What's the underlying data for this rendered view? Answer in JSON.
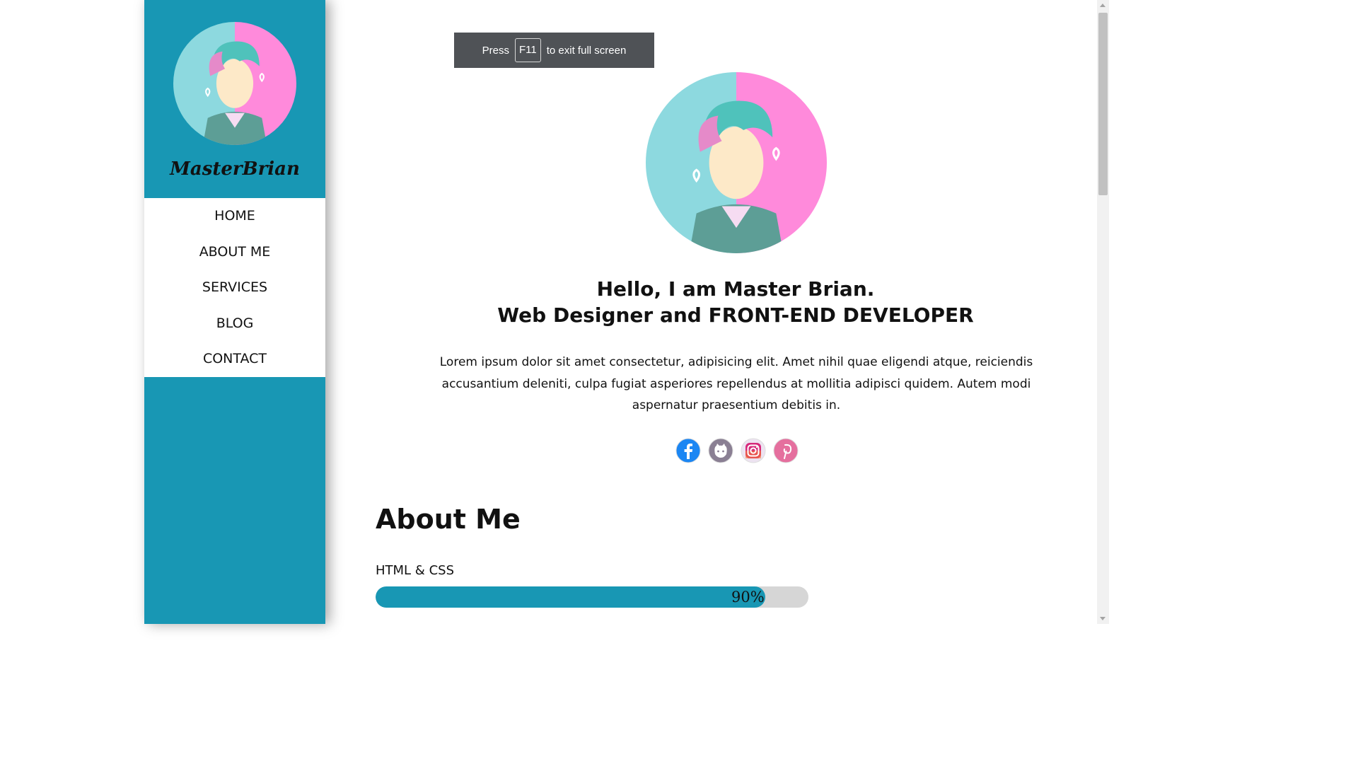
{
  "sidebar": {
    "brand": "MasterBrian",
    "avatar_icon": "avatar-illustration",
    "nav": [
      {
        "label": "HOME"
      },
      {
        "label": "ABOUT ME"
      },
      {
        "label": "SERVICES"
      },
      {
        "label": "BLOG"
      },
      {
        "label": "CONTACT"
      }
    ]
  },
  "toast": {
    "press": "Press",
    "key": "F11",
    "suffix": "to exit full screen"
  },
  "hero": {
    "line1": "Hello, I am Master Brian.",
    "line2": "Web Designer and FRONT-END DEVELOPER",
    "intro": "Lorem ipsum dolor sit amet consectetur, adipisicing elit. Amet nihil quae eligendi atque, reiciendis accusantium deleniti, culpa fugiat asperiores repellendus at mollitia adipisci quidem. Autem modi aspernatur praesentium debitis in."
  },
  "socials": [
    {
      "name": "facebook-icon"
    },
    {
      "name": "github-icon"
    },
    {
      "name": "instagram-icon"
    },
    {
      "name": "pinterest-icon"
    }
  ],
  "about": {
    "title": "About Me",
    "skills": [
      {
        "label": "HTML & CSS",
        "percent": 90,
        "percent_text": "90%"
      }
    ]
  },
  "colors": {
    "accent": "#1897b4",
    "avatar_left": "#8dd9df",
    "avatar_right": "#ff8adb",
    "bar_track": "#d6d6d6"
  }
}
